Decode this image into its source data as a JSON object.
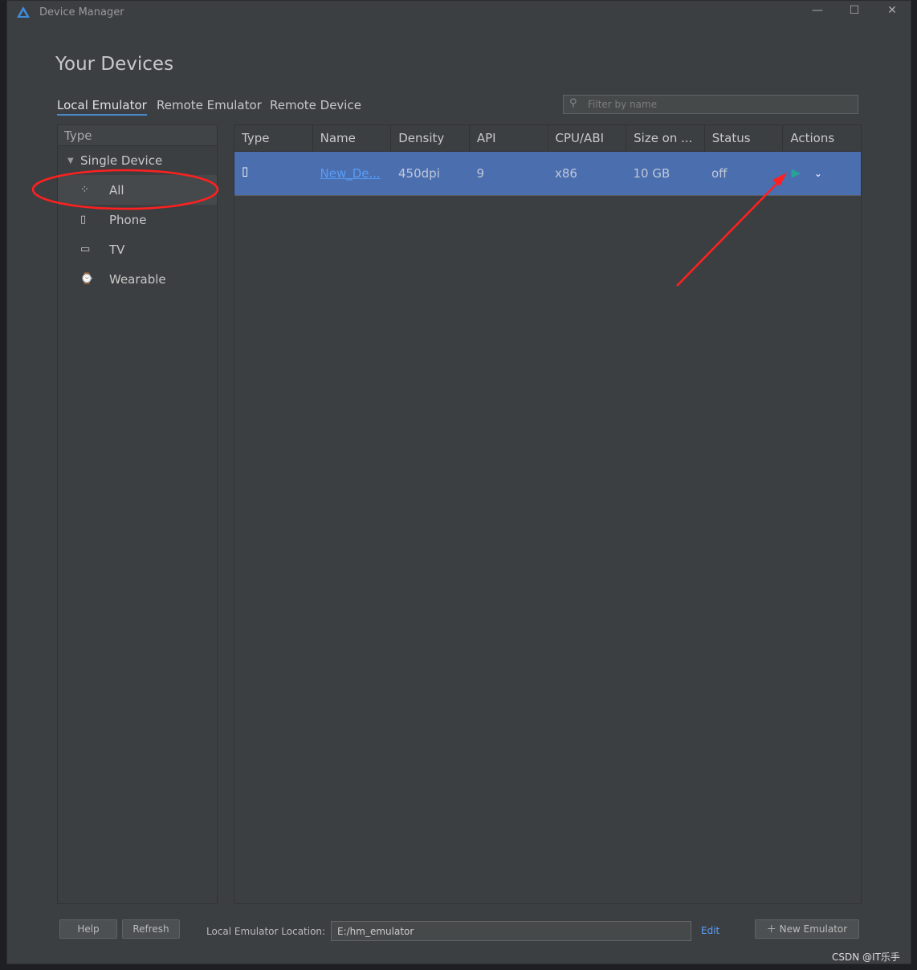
{
  "window": {
    "title": "Device Manager",
    "minimize": "—",
    "maximize": "☐",
    "close": "✕"
  },
  "heading": "Your Devices",
  "tabs": [
    {
      "label": "Local Emulator",
      "active": true
    },
    {
      "label": "Remote Emulator"
    },
    {
      "label": "Remote Device"
    }
  ],
  "filter": {
    "placeholder": "Filter by name"
  },
  "sidebar": {
    "header": "Type",
    "group": "Single Device",
    "items": [
      {
        "label": "All",
        "icon": "grid-icon",
        "selected": true
      },
      {
        "label": "Phone",
        "icon": "phone-icon"
      },
      {
        "label": "TV",
        "icon": "tv-icon"
      },
      {
        "label": "Wearable",
        "icon": "watch-icon"
      }
    ]
  },
  "table": {
    "columns": [
      "Type",
      "Name",
      "Density",
      "API",
      "CPU/ABI",
      "Size on ...",
      "Status",
      "Actions"
    ],
    "rows": [
      {
        "type": "phone-icon",
        "name": "New_De...",
        "density": "450dpi",
        "api": "9",
        "cpu": "x86",
        "size": "10 GB",
        "status": "off"
      }
    ]
  },
  "footer": {
    "help": "Help",
    "refresh": "Refresh",
    "location_label": "Local Emulator Location:",
    "location_value": "E:/hm_emulator",
    "edit": "Edit",
    "new_emulator": "New Emulator"
  },
  "watermark": "CSDN @IT乐手",
  "colors": {
    "selection": "#4b6eaf",
    "play": "#2aa198",
    "annotation": "#ff2020",
    "link": "#589df6"
  }
}
